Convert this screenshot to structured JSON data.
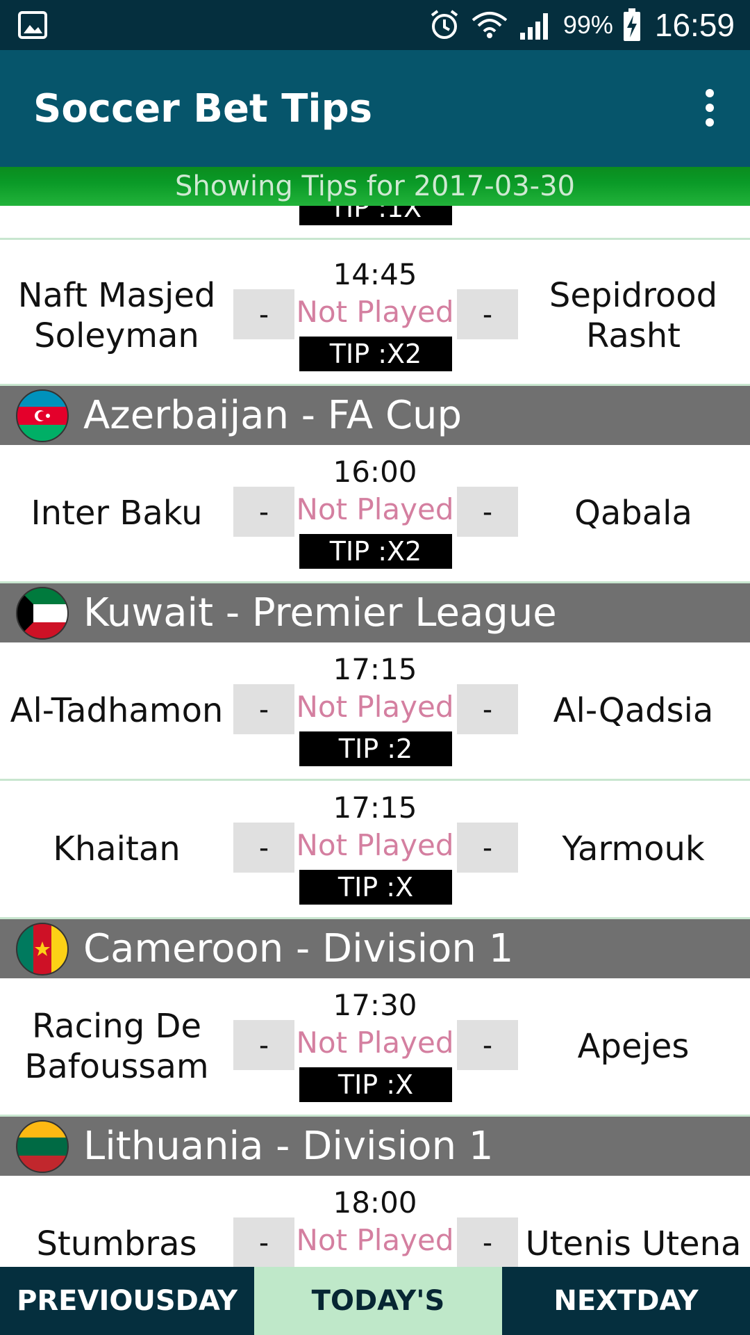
{
  "status_bar": {
    "battery_percent": "99%",
    "time": "16:59",
    "icons": [
      "gallery-notification-icon",
      "alarm-icon",
      "wifi-icon",
      "signal-icon",
      "battery-charging-icon"
    ]
  },
  "app_bar": {
    "title": "Soccer Bet Tips",
    "menu_icon": "more-vert-icon"
  },
  "date_banner": "Showing Tips for 2017-03-30",
  "partial_tip": "TIP :1X",
  "rows": [
    {
      "kind": "match",
      "home": "Naft Masjed Soleyman",
      "away": "Sepidrood Rasht",
      "time": "14:45",
      "status": "Not Played",
      "home_score": "-",
      "away_score": "-",
      "tip": "TIP :X2"
    },
    {
      "kind": "league",
      "name": "Azerbaijan - FA Cup",
      "flag": "azerbaijan-flag-icon"
    },
    {
      "kind": "match",
      "home": "Inter Baku",
      "away": "Qabala",
      "time": "16:00",
      "status": "Not Played",
      "home_score": "-",
      "away_score": "-",
      "tip": "TIP :X2"
    },
    {
      "kind": "league",
      "name": "Kuwait - Premier League",
      "flag": "kuwait-flag-icon"
    },
    {
      "kind": "match",
      "home": "Al-Tadhamon",
      "away": "Al-Qadsia",
      "time": "17:15",
      "status": "Not Played",
      "home_score": "-",
      "away_score": "-",
      "tip": "TIP :2"
    },
    {
      "kind": "match",
      "home": "Khaitan",
      "away": "Yarmouk",
      "time": "17:15",
      "status": "Not Played",
      "home_score": "-",
      "away_score": "-",
      "tip": "TIP :X"
    },
    {
      "kind": "league",
      "name": "Cameroon - Division 1",
      "flag": "cameroon-flag-icon"
    },
    {
      "kind": "match",
      "home": "Racing De Bafoussam",
      "away": "Apejes",
      "time": "17:30",
      "status": "Not Played",
      "home_score": "-",
      "away_score": "-",
      "tip": "TIP :X"
    },
    {
      "kind": "league",
      "name": "Lithuania - Division 1",
      "flag": "lithuania-flag-icon"
    },
    {
      "kind": "match",
      "home": "Stumbras",
      "away": "Utenis Utena",
      "time": "18:00",
      "status": "Not Played",
      "home_score": "-",
      "away_score": "-",
      "tip": ""
    }
  ],
  "bottom_nav": {
    "previous": "PREVIOUSDAY",
    "today": "TODAY'S",
    "next": "NEXTDAY"
  },
  "colors": {
    "status_bar": "#052f3e",
    "app_bar": "#06556b",
    "banner": "#0a9a27",
    "league_header": "#707070",
    "not_played": "#d47fa0",
    "today_tab": "#bfe8c9"
  }
}
